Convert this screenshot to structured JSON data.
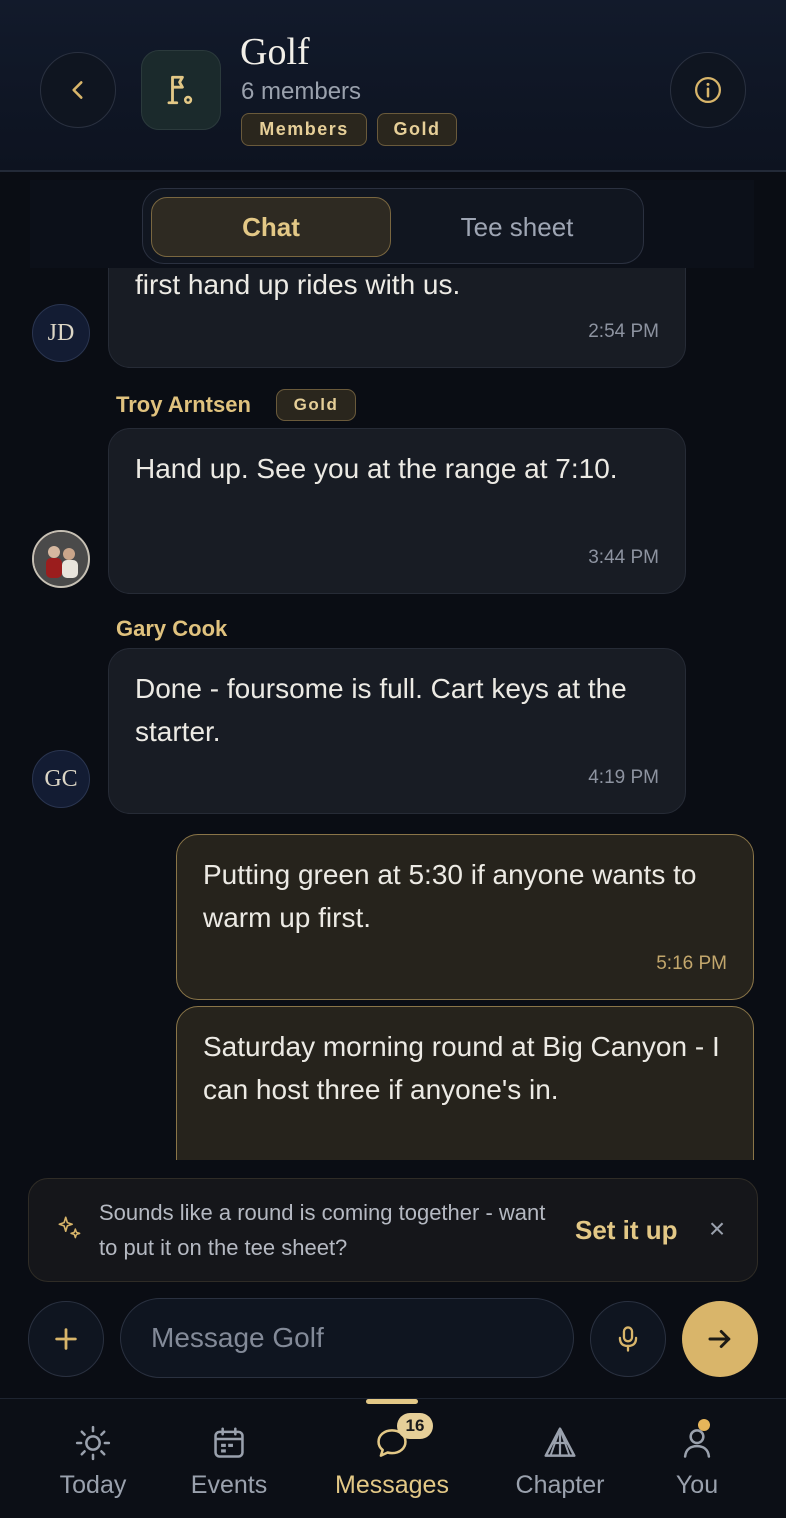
{
  "header": {
    "title": "Golf",
    "subtitle": "6 members",
    "badges": [
      "Members",
      "Gold"
    ],
    "back_icon": "chevron-left-icon",
    "info_icon": "info-icon",
    "group_icon": "golf-flag-icon"
  },
  "tabs": [
    {
      "label": "Chat",
      "active": true
    },
    {
      "label": "Tee sheet",
      "active": false
    }
  ],
  "messages": [
    {
      "avatar": "JD",
      "text": "first hand up rides with us.",
      "time": "2:54 PM",
      "mine": false
    },
    {
      "sender": "Troy Arntsen",
      "sender_badge": "Gold",
      "avatar": "photo",
      "text": "Hand up. See you at the range at 7:10.",
      "time": "3:44 PM",
      "mine": false
    },
    {
      "sender": "Gary Cook",
      "avatar": "GC",
      "text": "Done - foursome is full. Cart keys at the starter.",
      "time": "4:19 PM",
      "mine": false
    },
    {
      "text": "Putting green at 5:30 if anyone wants to warm up first.",
      "time": "5:16 PM",
      "mine": true
    },
    {
      "text": "Saturday morning round at Big Canyon - I can host three if anyone's in.",
      "mine": true
    }
  ],
  "suggestion": {
    "text": "Sounds like a round is coming together - want to put it on the tee sheet?",
    "action": "Set it up",
    "close": "×",
    "icon": "sparkle-icon"
  },
  "composer": {
    "placeholder": "Message Golf",
    "value": ""
  },
  "nav": {
    "items": [
      {
        "label": "Today",
        "icon": "sun-icon",
        "active": false
      },
      {
        "label": "Events",
        "icon": "calendar-icon",
        "active": false
      },
      {
        "label": "Messages",
        "icon": "chat-bubble-icon",
        "active": true,
        "badge": "16"
      },
      {
        "label": "Chapter",
        "icon": "pyramid-icon",
        "active": false
      },
      {
        "label": "You",
        "icon": "person-icon",
        "active": false,
        "dot": true
      }
    ]
  },
  "colors": {
    "accent": "#e3c886",
    "background": "#0a0d14",
    "send_button": "#d9b56a"
  }
}
